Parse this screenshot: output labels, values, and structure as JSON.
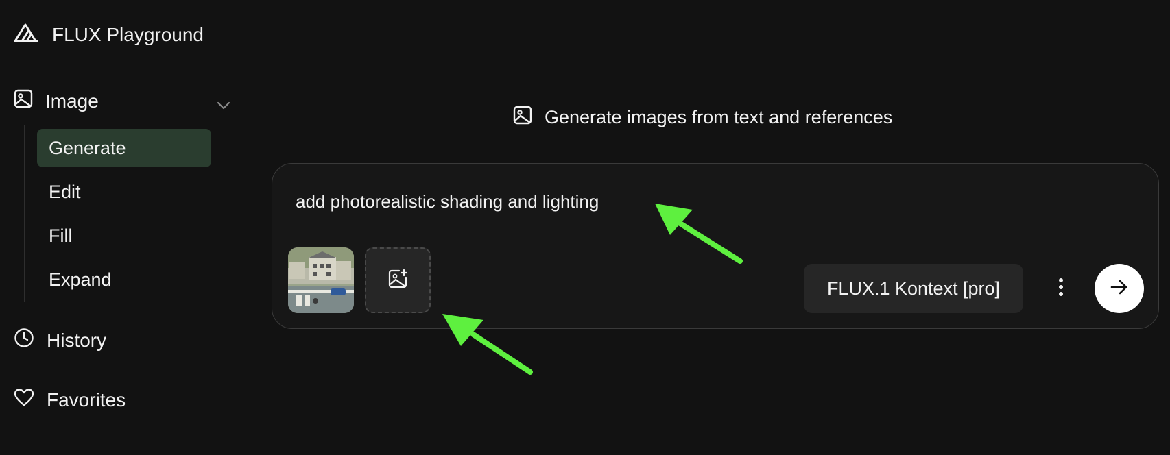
{
  "app": {
    "title": "FLUX Playground",
    "logo_icon": "flux-logo-icon"
  },
  "sidebar": {
    "image_section": {
      "label": "Image",
      "icon": "image-icon",
      "expanded": true,
      "items": [
        {
          "label": "Generate",
          "active": true
        },
        {
          "label": "Edit",
          "active": false
        },
        {
          "label": "Fill",
          "active": false
        },
        {
          "label": "Expand",
          "active": false
        }
      ]
    },
    "history": {
      "label": "History",
      "icon": "clock-icon"
    },
    "favorites": {
      "label": "Favorites",
      "icon": "heart-icon"
    }
  },
  "main": {
    "headline": "Generate images from text and references",
    "headline_icon": "image-icon",
    "prompt": {
      "value": "add photorealistic shading and lighting"
    },
    "reference_thumbnail_icon": "reference-image-thumbnail",
    "add_reference_icon": "image-plus-icon",
    "model": "FLUX.1 Kontext [pro]",
    "more_icon": "kebab-menu-icon",
    "submit_icon": "arrow-right-icon"
  },
  "colors": {
    "background": "#121212",
    "active_nav": "#2a3d2f",
    "card_border": "#3a3a3a",
    "annotation_arrow": "#5ef03f"
  }
}
